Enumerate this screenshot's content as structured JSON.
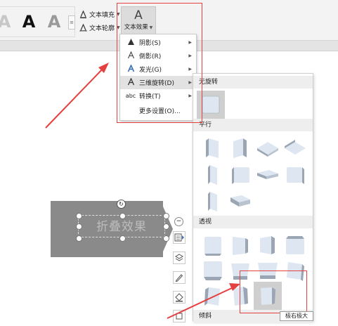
{
  "ribbon": {
    "style_samples": [
      "A",
      "A",
      "A"
    ],
    "style_scroll": "≡",
    "text_fill_label": "文本填充",
    "text_outline_label": "文本轮廓",
    "text_effect_label": "文本效果",
    "text_effect_glyph": "A"
  },
  "effects_menu": {
    "items": [
      {
        "label": "阴影(S)",
        "icon": "▲",
        "submenu": true
      },
      {
        "label": "倒影(R)",
        "icon": "A",
        "submenu": true
      },
      {
        "label": "发光(G)",
        "icon": "A",
        "submenu": true
      },
      {
        "label": "三维旋转(D)",
        "icon": "A",
        "submenu": true,
        "active": true
      },
      {
        "label": "转换(T)",
        "icon": "abc",
        "submenu": true
      },
      {
        "label": "更多设置(O)...",
        "icon": "",
        "submenu": false
      }
    ]
  },
  "gallery": {
    "sections": {
      "no_rotation": "无旋转",
      "parallel": "平行",
      "perspective": "透视",
      "oblique": "倾斜"
    },
    "tooltip": "极右极大"
  },
  "slide": {
    "shape_text": "折叠效果"
  },
  "float_toolbar": {
    "icons": [
      "layout-options-icon",
      "layers-icon",
      "pen-icon",
      "shape-fill-icon",
      "more-icon"
    ]
  },
  "colors": {
    "annotation_red": "#e54040",
    "shape_gray": "#8a8a8a",
    "cube_face": "#dde6f1",
    "cube_side": "#9aa6b4"
  }
}
